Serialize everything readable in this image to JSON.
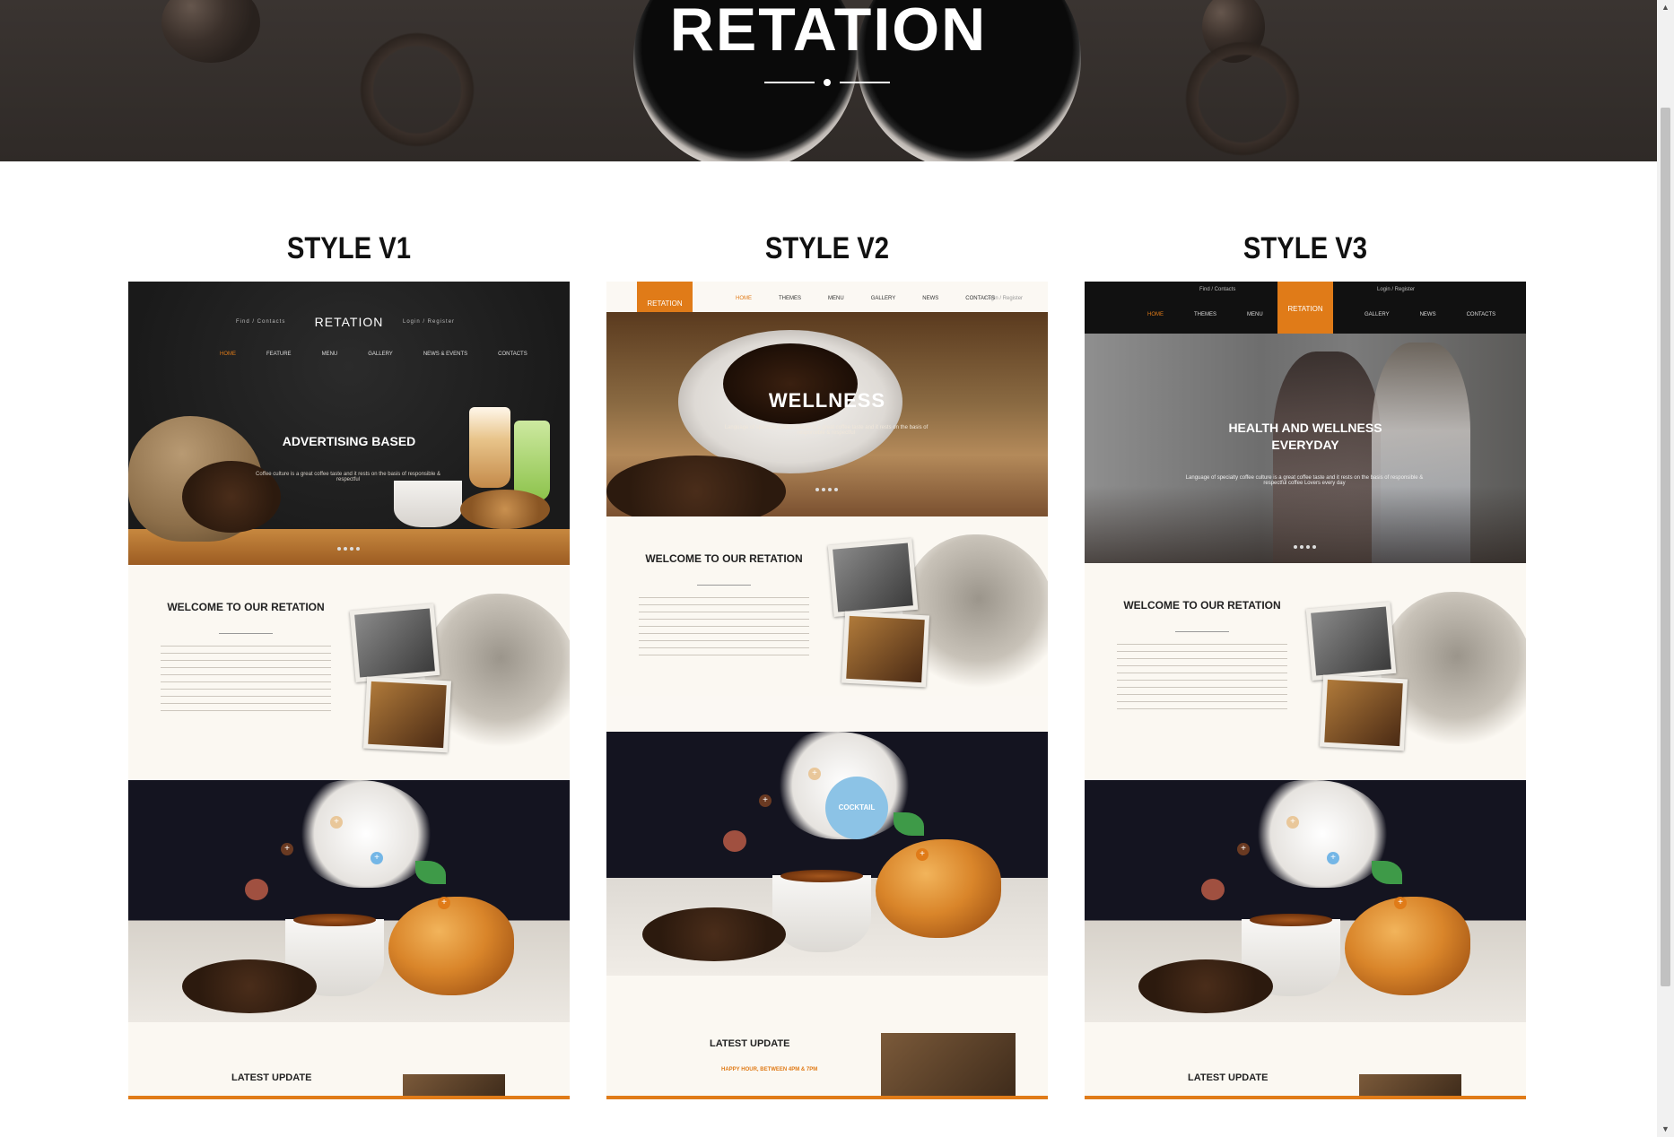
{
  "hero": {
    "title": "RETATION"
  },
  "styles": [
    {
      "title": "STYLE V1",
      "logo": "RETATION",
      "top_left": "Find / Contacts",
      "top_right": "Login / Register",
      "nav": [
        "HOME",
        "FEATURE",
        "MENU",
        "GALLERY",
        "NEWS & EVENTS",
        "CONTACTS"
      ],
      "slider_title": "ADVERTISING BASED",
      "slider_sub": "Coffee culture is a great coffee taste and it rests on the basis of responsible & respectful",
      "welcome_title": "WELCOME TO OUR RETATION",
      "latest_title": "LATEST UPDATE"
    },
    {
      "title": "STYLE V2",
      "logo": "RETATION",
      "nav": [
        "HOME",
        "THEMES",
        "MENU",
        "GALLERY",
        "NEWS",
        "CONTACTS"
      ],
      "top_right": "Login / Register",
      "slider_title": "WELLNESS",
      "slider_sub": "Language of specialty coffee culture is a great coffee taste and it rests on the basis of responsible & respectful",
      "welcome_title": "WELCOME TO OUR RETATION",
      "badge": "COCKTAIL",
      "latest_title": "LATEST UPDATE",
      "happy_hour": "HAPPY HOUR, BETWEEN 4PM & 7PM"
    },
    {
      "title": "STYLE V3",
      "logo": "RETATION",
      "top_left": "Find / Contacts",
      "top_right": "Login / Register",
      "nav_left": [
        "HOME",
        "THEMES",
        "MENU"
      ],
      "nav_right": [
        "GALLERY",
        "NEWS",
        "CONTACTS"
      ],
      "slider_title": "HEALTH AND WELLNESS EVERYDAY",
      "slider_sub": "Language of specialty coffee culture is a great coffee taste and it rests on the basis of responsible & respectful coffee Lovers every day",
      "welcome_title": "WELCOME TO OUR RETATION",
      "latest_title": "LATEST UPDATE"
    }
  ],
  "colors": {
    "accent": "#e07b18",
    "hero_bg": "#2f2a27",
    "dark": "#141420"
  }
}
